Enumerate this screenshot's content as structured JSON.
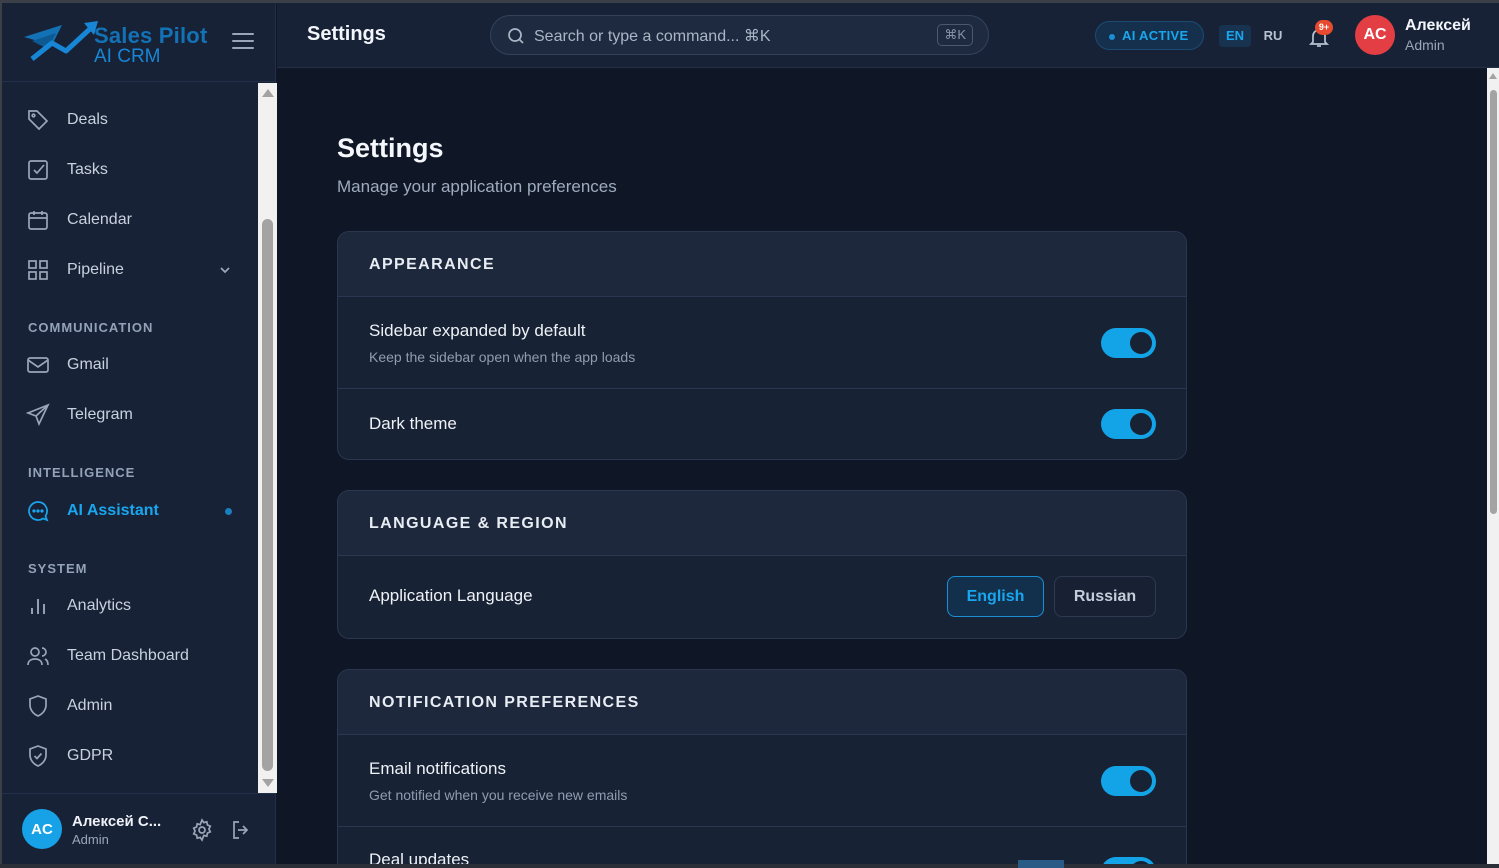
{
  "brand": {
    "name": "Sales Pilot",
    "subtitle": "AI CRM"
  },
  "sidebar": {
    "items_top": [
      {
        "label": "Deals",
        "icon": "tag-icon"
      },
      {
        "label": "Tasks",
        "icon": "checkbox-icon"
      },
      {
        "label": "Calendar",
        "icon": "calendar-icon"
      },
      {
        "label": "Pipeline",
        "icon": "grid-icon"
      }
    ],
    "sections": {
      "communication": "COMMUNICATION",
      "intelligence": "INTELLIGENCE",
      "system": "SYSTEM"
    },
    "communication_items": [
      {
        "label": "Gmail",
        "icon": "mail-icon"
      },
      {
        "label": "Telegram",
        "icon": "send-icon"
      }
    ],
    "intelligence_items": [
      {
        "label": "AI Assistant",
        "icon": "chat-bubble-icon",
        "active": true
      }
    ],
    "system_items": [
      {
        "label": "Analytics",
        "icon": "bar-chart-icon"
      },
      {
        "label": "Team Dashboard",
        "icon": "users-icon"
      },
      {
        "label": "Admin",
        "icon": "shield-icon"
      },
      {
        "label": "GDPR",
        "icon": "shield-check-icon"
      }
    ],
    "user": {
      "initials": "AC",
      "name": "Алексей С...",
      "role": "Admin"
    }
  },
  "header": {
    "title": "Settings",
    "search_placeholder": "Search or type a command... ⌘K",
    "search_shortcut": "⌘K",
    "ai_status": "AI ACTIVE",
    "lang_en": "EN",
    "lang_ru": "RU",
    "notification_count": "9+",
    "user": {
      "initials": "AC",
      "name": "Алексей",
      "role": "Admin"
    }
  },
  "main": {
    "title": "Settings",
    "subtitle": "Manage your application preferences",
    "appearance": {
      "heading": "APPEARANCE",
      "sidebar_title": "Sidebar expanded by default",
      "sidebar_desc": "Keep the sidebar open when the app loads",
      "sidebar_on": true,
      "dark_title": "Dark theme",
      "dark_on": true
    },
    "language": {
      "heading": "LANGUAGE & REGION",
      "app_language_label": "Application Language",
      "options": [
        "English",
        "Russian"
      ],
      "selected": "English"
    },
    "notifications": {
      "heading": "NOTIFICATION PREFERENCES",
      "email_title": "Email notifications",
      "email_desc": "Get notified when you receive new emails",
      "email_on": true,
      "deal_title": "Deal updates"
    }
  },
  "colors": {
    "accent": "#13a4e8",
    "background": "#0f1626",
    "sidebar": "#182236",
    "avatar_red": "#e23e44",
    "badge_orange": "#e84a2f"
  }
}
